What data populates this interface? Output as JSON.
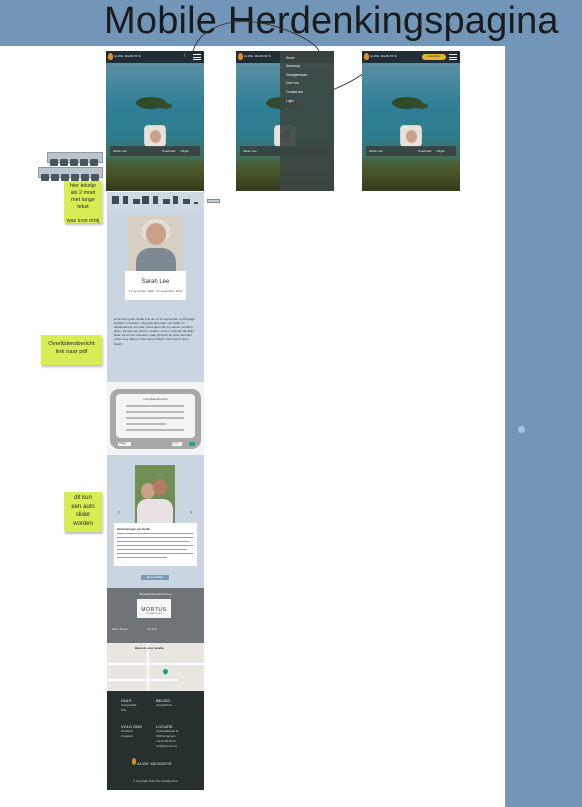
{
  "board": {
    "title": "Mobile Herdenkingspagina"
  },
  "colors": {
    "band": "#7296b8",
    "sticky": "#d8ec55",
    "footer": "#26302e",
    "accent": "#e0b62c"
  },
  "frames": {
    "logo": "ALWE MEMORIS",
    "name": "Sarah Lee",
    "deceased_label": "Overleden",
    "action_label": "Volgen",
    "menu_items": [
      "Home",
      "Aanvraag",
      "Gedagtenissen",
      "Over ons",
      "Contact ons",
      "Login"
    ],
    "yellow_button": "Aanmelden"
  },
  "stickies": [
    "hier tekstje\nals 2 moet\nmet lange tekst\n\nwas icon erbij",
    "Overlijdensbericht\nlink naar pdf",
    "dit kun\neen auto\nslider\nworden"
  ],
  "memorial": {
    "name": "Sarah Lee",
    "dates": "17 november 1935 - 21 september 2021",
    "bio": "Herinnering aan Sarah Lee die op 21 september op 86 jarige leeftijd is overleden. Wij gedenken haar met liefde en dankbaarheid voor alle mooie jaren die we samen mochten delen. Zij was een warme moeder, oma en vriendin die altijd klaar stond voor iedereen. Haar glimlach en wijze woorden zullen voor altijd in onze harten blijven. Rust zacht, lieve Sarah.",
    "pdf_title": "Overlijdensbericht",
    "pdf_prev": "Vorige",
    "pdf_page": "1 / 2",
    "story_title": "Herinneringen aan Sarah",
    "more_button": "Meer verhalen",
    "undertaker_title": "Begrafenisonderneming",
    "undertaker_name": "MORTUS",
    "undertaker_sub": "UITVAARTZORG",
    "undertaker_left": "Naam: Mortus",
    "undertaker_right": "Tel: 0123",
    "map_title": "Bezoek onze locatie",
    "footer": {
      "help": "HULP",
      "help_links": [
        "Veelgestelde",
        "FAQ"
      ],
      "policy": "BELEID",
      "policy_links": [
        "privacybeleid"
      ],
      "follow": "VOLG ONS",
      "follow_links": [
        "Facebook",
        "Instagram"
      ],
      "location": "LOCATIE",
      "location_lines": [
        "Voorbeeldstraat 11",
        "1000 Antwerpen",
        "+32 00 00 00 00",
        "info@memoris.be"
      ],
      "logo": "ALWE MEMORIS",
      "copyright": "© Copyright 2021 The Sunday Crew"
    }
  }
}
